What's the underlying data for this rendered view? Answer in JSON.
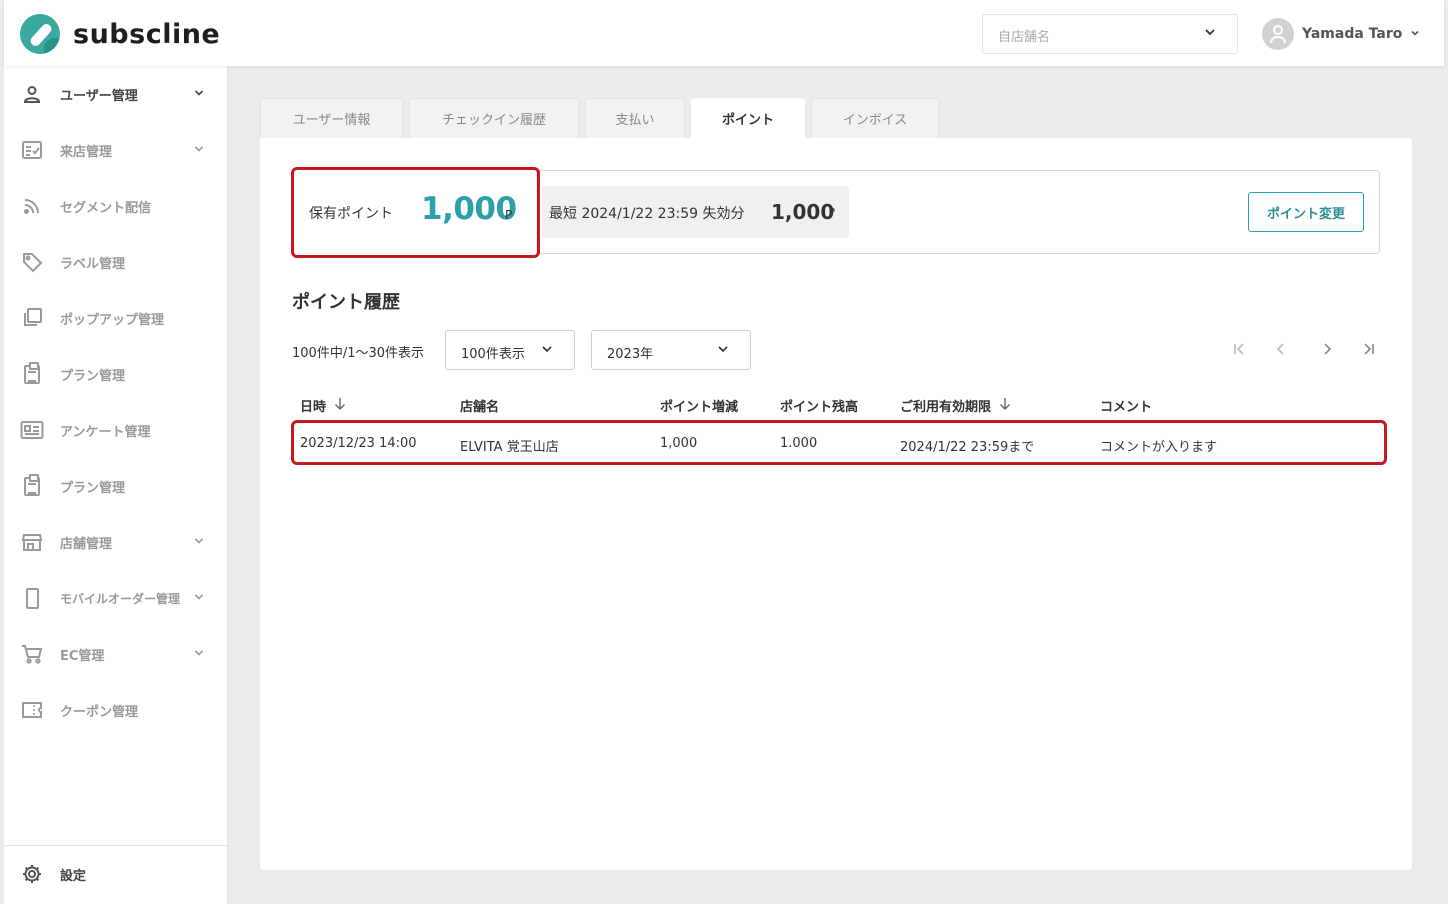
{
  "app": {
    "brand": "subscline",
    "store_select": {
      "placeholder": "自店舗名"
    },
    "user": {
      "name": "Yamada Taro"
    }
  },
  "sidebar": {
    "items": [
      {
        "label": "ユーザー管理",
        "icon": "person-icon",
        "active": true,
        "expandable": true
      },
      {
        "label": "来店管理",
        "icon": "checklist-icon",
        "expandable": true
      },
      {
        "label": "セグメント配信",
        "icon": "rss-icon"
      },
      {
        "label": "ラベル管理",
        "icon": "tag-icon"
      },
      {
        "label": "ポップアップ管理",
        "icon": "popup-icon"
      },
      {
        "label": "プラン管理",
        "icon": "clipboard-icon"
      },
      {
        "label": "アンケート管理",
        "icon": "survey-card-icon"
      },
      {
        "label": "プラン管理",
        "icon": "clipboard-icon"
      },
      {
        "label": "店舗管理",
        "icon": "store-icon",
        "expandable": true
      },
      {
        "label": "モバイルオーダー管理",
        "icon": "mobile-icon",
        "expandable": true
      },
      {
        "label": "EC管理",
        "icon": "cart-icon",
        "expandable": true
      },
      {
        "label": "クーポン管理",
        "icon": "coupon-icon"
      }
    ],
    "settings": {
      "label": "設定",
      "icon": "gear-icon"
    }
  },
  "tabs": [
    {
      "label": "ユーザー情報"
    },
    {
      "label": "チェックイン履歴"
    },
    {
      "label": "支払い"
    },
    {
      "label": "ポイント",
      "active": true
    },
    {
      "label": "インボイス"
    }
  ],
  "points": {
    "held_label": "保有ポイント",
    "held_value": "1,000",
    "unit": "P",
    "expire_label": "最短 2024/1/22 23:59 失効分",
    "expire_value": "1,000",
    "change_button": "ポイント変更"
  },
  "history": {
    "title": "ポイント履歴",
    "count_text": "100件中/1〜30件表示",
    "per_page": "100件表示",
    "year": "2023年",
    "columns": [
      "日時",
      "店舗名",
      "ポイント増減",
      "ポイント残高",
      "ご利用有効期限",
      "コメント"
    ],
    "rows": [
      [
        "2023/12/23 14:00",
        "ELVITA 覚王山店",
        "1,000",
        "1.000",
        "2024/1/22 23:59まで",
        "コメントが入ります"
      ]
    ]
  },
  "colors": {
    "accent": "#2ba0aa",
    "highlight": "#c8171e",
    "brand": "#3aa99f"
  }
}
